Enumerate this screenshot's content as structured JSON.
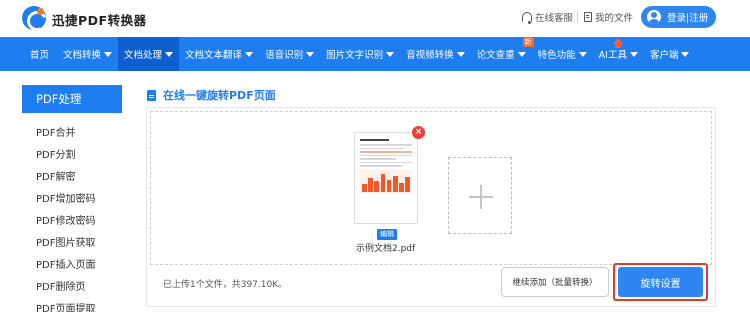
{
  "header": {
    "brand": "迅捷PDF转换器",
    "service_label": "在线客服",
    "myfiles_label": "我的文件",
    "login_label": "登录|注册"
  },
  "nav": {
    "items": [
      {
        "label": "首页"
      },
      {
        "label": "文档转换"
      },
      {
        "label": "文档处理"
      },
      {
        "label": "文档文本翻译"
      },
      {
        "label": "语音识别"
      },
      {
        "label": "图片文字识别"
      },
      {
        "label": "音视频转换"
      },
      {
        "label": "论文查重"
      },
      {
        "label": "特色功能"
      },
      {
        "label": "AI工具"
      },
      {
        "label": "客户端"
      }
    ],
    "new_badge": "新"
  },
  "sidebar": {
    "title": "PDF处理",
    "items": [
      {
        "label": "PDF合并"
      },
      {
        "label": "PDF分割"
      },
      {
        "label": "PDF解密"
      },
      {
        "label": "PDF增加密码"
      },
      {
        "label": "PDF修改密码"
      },
      {
        "label": "PDF图片获取"
      },
      {
        "label": "PDF插入页面"
      },
      {
        "label": "PDF删除页"
      },
      {
        "label": "PDF页面提取"
      }
    ]
  },
  "main": {
    "title": "在线一键旋转PDF页面",
    "file": {
      "name": "示例文档2.pdf",
      "edit_label": "编辑",
      "close_symbol": "×"
    },
    "upload_info": "已上传1个文件，共397.10K。",
    "continue_label": "继续添加（批量转换）",
    "rotate_label": "旋转设置"
  },
  "colors": {
    "primary": "#1e7ef0",
    "nav_active": "#0e5fcf",
    "highlight_border": "#e03a2a",
    "close": "#f23d3d",
    "badge": "#ff6a2b"
  }
}
